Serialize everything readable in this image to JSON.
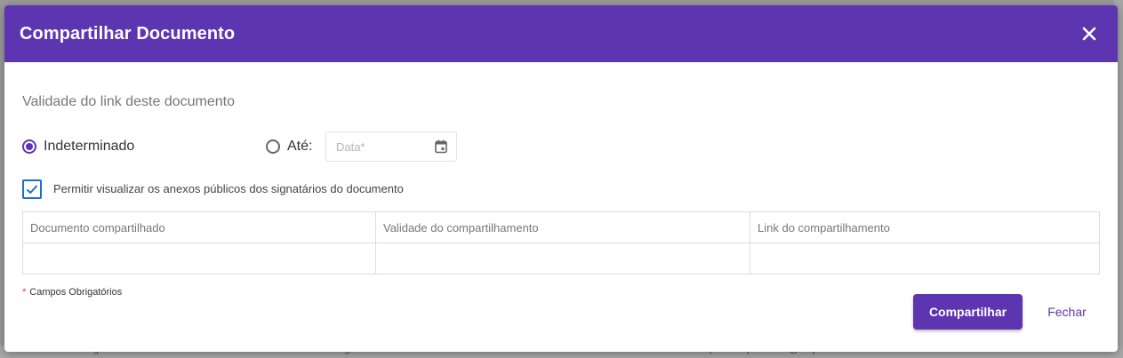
{
  "dialog": {
    "title": "Compartilhar Documento",
    "section_label": "Validade do link deste documento",
    "validity": {
      "option_indeterminate": "Indeterminado",
      "option_until": "Até:",
      "selected": "Indeterminado",
      "date_placeholder": "Data*"
    },
    "checkbox": {
      "label": "Permitir visualizar os anexos públicos dos signatários do documento",
      "checked": true
    },
    "table": {
      "columns": [
        "Documento compartilhado",
        "Validade do compartilhamento",
        "Link do compartilhamento"
      ],
      "rows": []
    },
    "required_note": "Campos Obrigatórios",
    "required_mark": "*",
    "buttons": {
      "primary": "Compartilhar",
      "secondary": "Fechar"
    }
  },
  "background": {
    "bottom_text": "1 Signatário · ICP Outros · Pessoa Física · Anexos · Obrigatório",
    "bottom_text_right": "Cláudia Natália das Neves (Cria 30) · cria30@arquivus.com",
    "bottom_date": "16/06/2022 18:38"
  },
  "colors": {
    "accent": "#5e35b1",
    "checkbox": "#1e6fd0",
    "required_star": "#e53935"
  }
}
